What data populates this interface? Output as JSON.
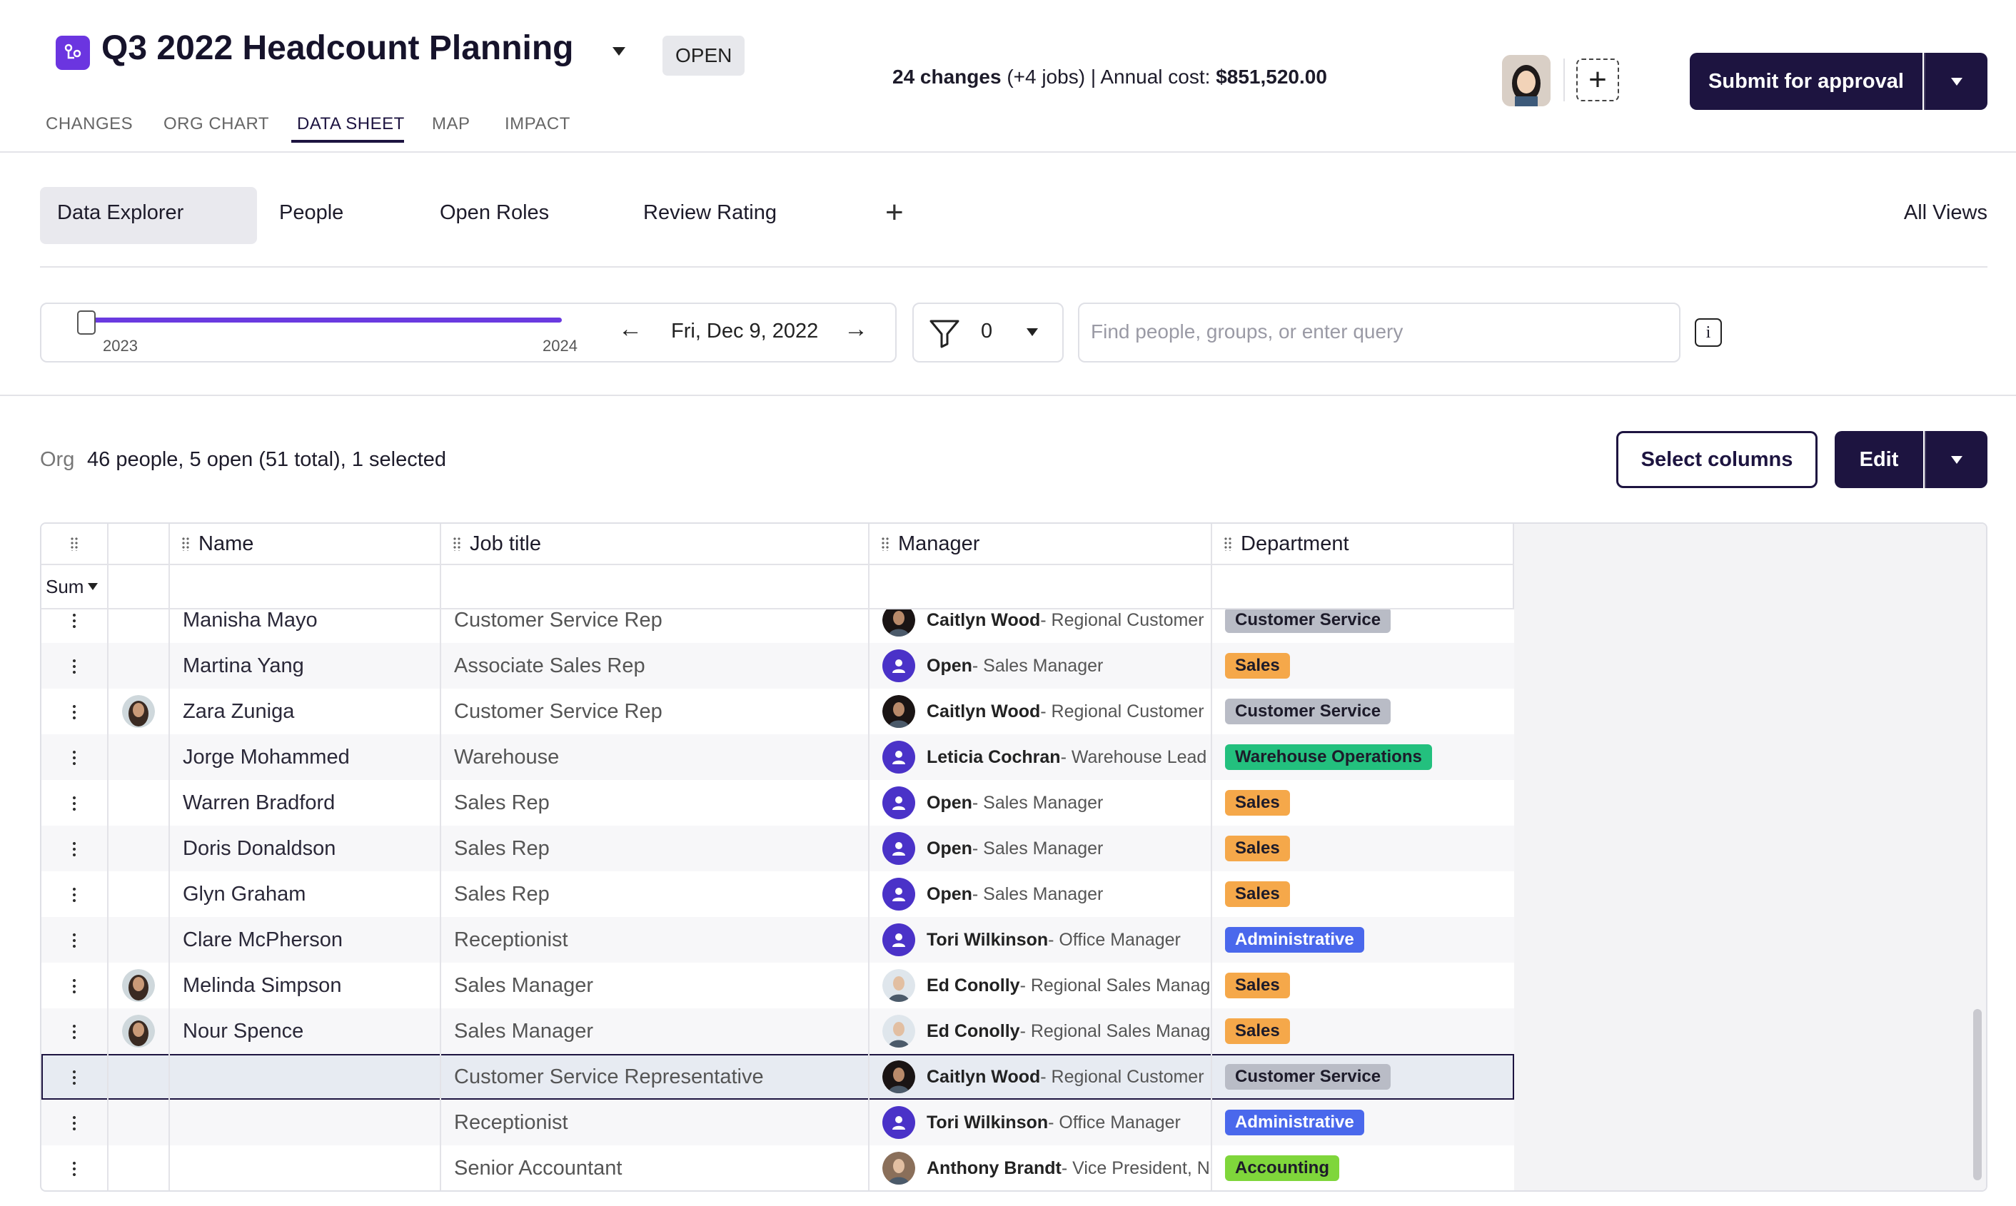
{
  "header": {
    "title": "Q3 2022 Headcount Planning",
    "status": "OPEN",
    "summary_changes": "24 changes",
    "summary_jobs": "(+4 jobs)",
    "summary_cost_label": "| Annual cost:",
    "summary_cost": "$851,520.00",
    "submit_label": "Submit for approval"
  },
  "nav": {
    "tabs": [
      "CHANGES",
      "ORG CHART",
      "DATA SHEET",
      "MAP",
      "IMPACT"
    ],
    "active": "DATA SHEET"
  },
  "views": {
    "tabs": [
      "Data Explorer",
      "People",
      "Open Roles",
      "Review Rating"
    ],
    "active": "Data Explorer",
    "all_views_label": "All Views"
  },
  "controls": {
    "timeline_start": "2023",
    "timeline_end": "2024",
    "current_date": "Fri, Dec 9, 2022",
    "filter_count": "0",
    "search_placeholder": "Find people, groups, or enter query"
  },
  "org": {
    "label": "Org",
    "count_text": "46 people, 5 open (51 total), 1 selected",
    "select_columns_label": "Select columns",
    "edit_label": "Edit"
  },
  "grid": {
    "columns": [
      "Name",
      "Job title",
      "Manager",
      "Department"
    ],
    "sum_label": "Sum",
    "rows": [
      {
        "name": "Manisha Mayo",
        "job": "Customer Service Rep",
        "manager_name": "Caitlyn Wood",
        "manager_title": " - Regional Customer",
        "dept": "Customer Service",
        "avatar": false,
        "mgr_kind": "photo-dark"
      },
      {
        "name": "Martina Yang",
        "job": "Associate Sales Rep",
        "manager_name": "Open",
        "manager_title": " - Sales Manager",
        "dept": "Sales",
        "avatar": false,
        "mgr_kind": "open"
      },
      {
        "name": "Zara Zuniga",
        "job": "Customer Service Rep",
        "manager_name": "Caitlyn Wood",
        "manager_title": " - Regional Customer",
        "dept": "Customer Service",
        "avatar": true,
        "mgr_kind": "photo-dark"
      },
      {
        "name": "Jorge Mohammed",
        "job": "Warehouse",
        "manager_name": "Leticia Cochran",
        "manager_title": " - Warehouse Lead",
        "dept": "Warehouse Operations",
        "avatar": false,
        "mgr_kind": "open"
      },
      {
        "name": "Warren Bradford",
        "job": "Sales Rep",
        "manager_name": "Open",
        "manager_title": " - Sales Manager",
        "dept": "Sales",
        "avatar": false,
        "mgr_kind": "open"
      },
      {
        "name": "Doris Donaldson",
        "job": "Sales Rep",
        "manager_name": "Open",
        "manager_title": " - Sales Manager",
        "dept": "Sales",
        "avatar": false,
        "mgr_kind": "open"
      },
      {
        "name": "Glyn Graham",
        "job": "Sales Rep",
        "manager_name": "Open",
        "manager_title": " - Sales Manager",
        "dept": "Sales",
        "avatar": false,
        "mgr_kind": "open"
      },
      {
        "name": "Clare McPherson",
        "job": "Receptionist",
        "manager_name": "Tori Wilkinson",
        "manager_title": " - Office Manager",
        "dept": "Administrative",
        "avatar": false,
        "mgr_kind": "open"
      },
      {
        "name": "Melinda Simpson",
        "job": "Sales Manager",
        "manager_name": "Ed Conolly",
        "manager_title": " - Regional Sales Manag",
        "dept": "Sales",
        "avatar": true,
        "mgr_kind": "photo-light"
      },
      {
        "name": "Nour Spence",
        "job": "Sales Manager",
        "manager_name": "Ed Conolly",
        "manager_title": " - Regional Sales Manag",
        "dept": "Sales",
        "avatar": true,
        "mgr_kind": "photo-light"
      },
      {
        "name": "",
        "job": "Customer Service Representative",
        "manager_name": "Caitlyn Wood",
        "manager_title": " - Regional Customer",
        "dept": "Customer Service",
        "avatar": false,
        "mgr_kind": "photo-dark",
        "selected": true
      },
      {
        "name": "",
        "job": "Receptionist",
        "manager_name": "Tori Wilkinson",
        "manager_title": " - Office Manager",
        "dept": "Administrative",
        "avatar": false,
        "mgr_kind": "open"
      },
      {
        "name": "",
        "job": "Senior Accountant",
        "manager_name": "Anthony Brandt",
        "manager_title": " - Vice President, Ne",
        "dept": "Accounting",
        "avatar": false,
        "mgr_kind": "photo-mid"
      }
    ]
  },
  "dept_colors": {
    "Customer Service": "#b9bcc6",
    "Sales": "#f5a84a",
    "Warehouse Operations": "#23c07e",
    "Administrative": "#4a68ec",
    "Accounting": "#7fd63b"
  },
  "colors": {
    "brand": "#1d1440",
    "accent": "#6a3ae0"
  }
}
